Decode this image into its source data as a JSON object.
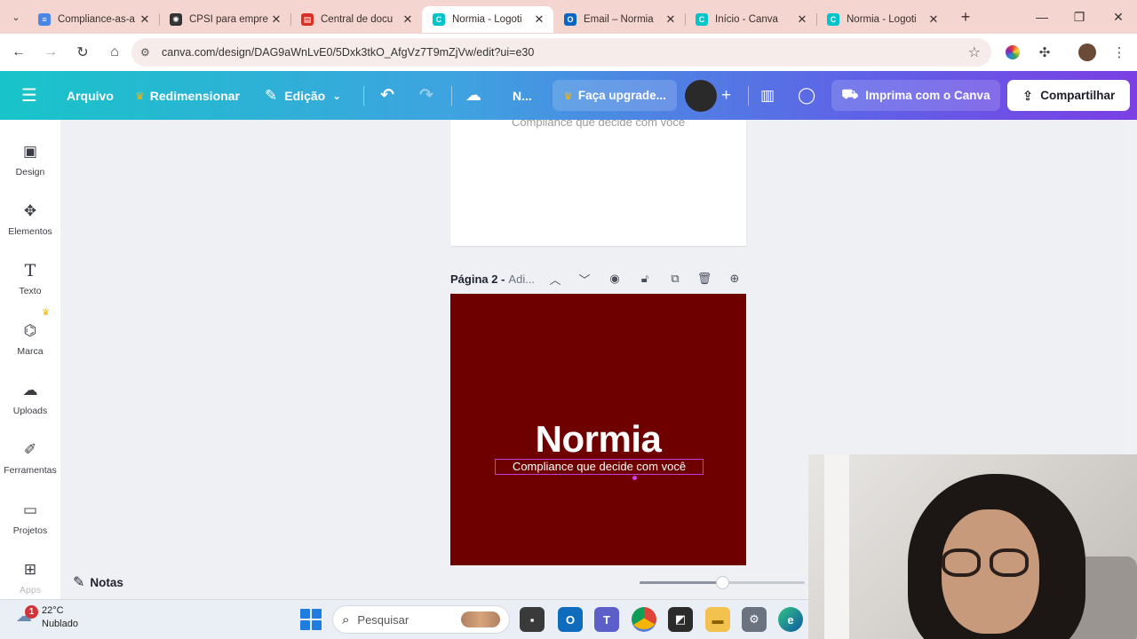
{
  "browser": {
    "tabs": [
      {
        "title": "Compliance-as-a",
        "favicon_color": "#4a86e8",
        "favicon_glyph": "≡",
        "active": false
      },
      {
        "title": "CPSI para empre",
        "favicon_color": "#333333",
        "favicon_glyph": "✺",
        "active": false
      },
      {
        "title": "Central de docu",
        "favicon_color": "#d93025",
        "favicon_glyph": "▤",
        "active": false
      },
      {
        "title": "Normia - Logoti",
        "favicon_color": "#00c4cc",
        "favicon_glyph": "C",
        "active": true
      },
      {
        "title": "Email – Normia",
        "favicon_color": "#0a66c2",
        "favicon_glyph": "O",
        "active": false
      },
      {
        "title": "Início - Canva",
        "favicon_color": "#00c4cc",
        "favicon_glyph": "C",
        "active": false
      },
      {
        "title": "Normia - Logoti",
        "favicon_color": "#00c4cc",
        "favicon_glyph": "C",
        "active": false
      }
    ],
    "url": "canva.com/design/DAG9aWnLvE0/5Dxk3tkO_AfgVz7T9mZjVw/edit?ui=e30"
  },
  "canva_header": {
    "menu_icon": "hamburger-icon",
    "file_label": "Arquivo",
    "resize_label": "Redimensionar",
    "edit_label": "Edição",
    "title_short": "N...",
    "upgrade_label": "Faça upgrade...",
    "print_label": "Imprima com o Canva",
    "share_label": "Compartilhar",
    "crown_color": "#f5b400"
  },
  "sidebar": {
    "items": [
      {
        "label": "Design",
        "icon": "layout-icon"
      },
      {
        "label": "Elementos",
        "icon": "shapes-icon"
      },
      {
        "label": "Texto",
        "icon": "text-icon"
      },
      {
        "label": "Marca",
        "icon": "brand-icon"
      },
      {
        "label": "Uploads",
        "icon": "cloud-upload-icon"
      },
      {
        "label": "Ferramentas",
        "icon": "pen-tool-icon"
      },
      {
        "label": "Projetos",
        "icon": "folder-icon"
      },
      {
        "label": "Apps",
        "icon": "apps-grid-icon"
      }
    ]
  },
  "canvas": {
    "page1_slogan": "Compliance que decide com você",
    "page2_label": "Página 2 -",
    "page2_sub": "Adi...",
    "page2_bg": "#6e0000",
    "logo_word": "Normia",
    "logo_slogan": "Compliance que decide com você",
    "notes_label": "Notas",
    "zoom_level": 0.5
  },
  "taskbar": {
    "temperature": "22°C",
    "weather": "Nublado",
    "notification_count": "1",
    "search_placeholder": "Pesquisar"
  }
}
